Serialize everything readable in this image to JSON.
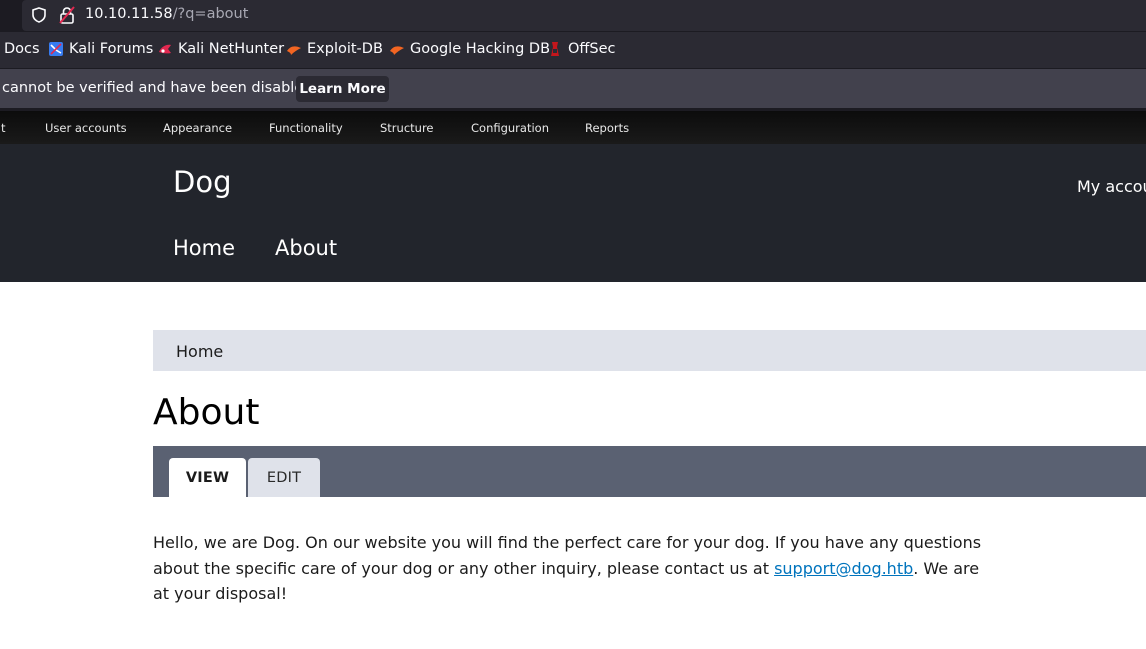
{
  "browser": {
    "url_host": "10.10.11.58",
    "url_path": "/?q=about",
    "bookmarks": [
      {
        "label": "Docs",
        "icon": "docs-icon"
      },
      {
        "label": "Kali Forums",
        "icon": "kali-forums-icon"
      },
      {
        "label": "Kali NetHunter",
        "icon": "kali-nethunter-icon"
      },
      {
        "label": "Exploit-DB",
        "icon": "exploit-db-icon"
      },
      {
        "label": "Google Hacking DB",
        "icon": "google-hacking-db-icon"
      },
      {
        "label": "OffSec",
        "icon": "offsec-icon"
      }
    ],
    "notification": {
      "text": "cannot be verified and have been disabled.",
      "button_label": "Learn More"
    }
  },
  "admin_bar": {
    "items": [
      {
        "label": "t"
      },
      {
        "label": "User accounts"
      },
      {
        "label": "Appearance"
      },
      {
        "label": "Functionality"
      },
      {
        "label": "Structure"
      },
      {
        "label": "Configuration"
      },
      {
        "label": "Reports"
      }
    ]
  },
  "header": {
    "site_name": "Dog",
    "my_account": "My accou",
    "nav": [
      {
        "label": "Home"
      },
      {
        "label": "About"
      }
    ]
  },
  "main": {
    "breadcrumb": [
      "Home"
    ],
    "title": "About",
    "tabs": [
      {
        "label": "VIEW",
        "active": true
      },
      {
        "label": "EDIT",
        "active": false
      }
    ],
    "body": {
      "before_link": "Hello, we are Dog. On our website you will find the perfect care for your dog. If you have any questions about the specific care of your dog or any other inquiry, please contact us at ",
      "link_text": "support@dog.htb",
      "after_link": ". We are at your disposal!"
    }
  },
  "colors": {
    "header_bg": "#22252c",
    "breadcrumb_bg": "#dfe2ea",
    "tabs_bg": "#5a6172",
    "link": "#0074bd"
  }
}
